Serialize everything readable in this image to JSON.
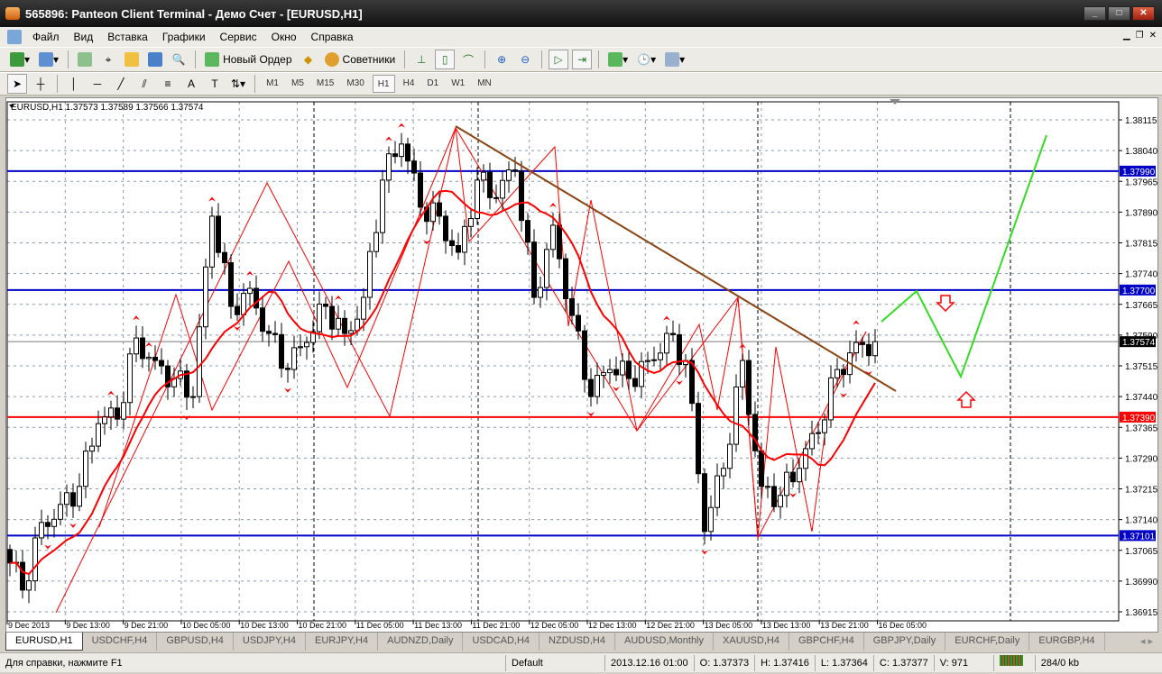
{
  "window": {
    "title": "565896: Panteon Client Terminal - Демо Счет - [EURUSD,H1]"
  },
  "menu": [
    "Файл",
    "Вид",
    "Вставка",
    "Графики",
    "Сервис",
    "Окно",
    "Справка"
  ],
  "toolbar": {
    "new_order": "Новый Ордер",
    "advisors": "Советники"
  },
  "tools": {
    "text_tool": "A"
  },
  "timeframes": [
    "M1",
    "M5",
    "M15",
    "M30",
    "H1",
    "H4",
    "D1",
    "W1",
    "MN"
  ],
  "active_timeframe": "H1",
  "chart": {
    "header": "EURUSD,H1  1.37573 1.37589 1.37566 1.37574",
    "price_ticks": [
      "1.38115",
      "1.38040",
      "1.37965",
      "1.37890",
      "1.37815",
      "1.37740",
      "1.37665",
      "1.37590",
      "1.37515",
      "1.37440",
      "1.37365",
      "1.37290",
      "1.37215",
      "1.37140",
      "1.37065",
      "1.36990",
      "1.36915"
    ],
    "time_labels": [
      "9 Dec 2013",
      "9 Dec 13:00",
      "9 Dec 21:00",
      "10 Dec 05:00",
      "10 Dec 13:00",
      "10 Dec 21:00",
      "11 Dec 05:00",
      "11 Dec 13:00",
      "11 Dec 21:00",
      "12 Dec 05:00",
      "12 Dec 13:00",
      "12 Dec 21:00",
      "13 Dec 05:00",
      "13 Dec 13:00",
      "13 Dec 21:00",
      "16 Dec 05:00"
    ],
    "levels": [
      {
        "price": "1.37990",
        "color": "#0000c8"
      },
      {
        "price": "1.37700",
        "color": "#0000c8"
      },
      {
        "price": "1.37390",
        "color": "#ff0000"
      },
      {
        "price": "1.37101",
        "color": "#0000c8"
      }
    ],
    "current_price": "1.37574",
    "closes": [
      1.37067,
      1.36968,
      1.37133,
      1.37177,
      1.37221,
      1.37374,
      1.37385,
      1.37583,
      1.37528,
      1.37484,
      1.3744,
      1.3788,
      1.3766,
      1.37704,
      1.37594,
      1.37506,
      1.37572,
      1.3766,
      1.37594,
      1.37682,
      1.37968,
      1.38056,
      1.37902,
      1.3788,
      1.37792,
      1.37968,
      1.37924,
      1.3799,
      1.37682,
      1.37858,
      1.37638,
      1.3744,
      1.37506,
      1.37484,
      1.37528,
      1.37594,
      1.37528,
      1.37111,
      1.37265,
      1.37528,
      1.37221,
      1.37199,
      1.37265,
      1.37352,
      1.37506,
      1.37572,
      1.37574
    ]
  },
  "tabs": [
    "EURUSD,H1",
    "USDCHF,H4",
    "GBPUSD,H4",
    "USDJPY,H4",
    "EURJPY,H4",
    "AUDNZD,Daily",
    "USDCAD,H4",
    "NZDUSD,H4",
    "AUDUSD,Monthly",
    "XAUUSD,H4",
    "GBPCHF,H4",
    "GBPJPY,Daily",
    "EURCHF,Daily",
    "EURGBP,H4"
  ],
  "status": {
    "help": "Для справки, нажмите F1",
    "profile": "Default",
    "time": "2013.12.16 01:00",
    "open": "O: 1.37373",
    "high": "H: 1.37416",
    "low": "L: 1.37364",
    "close": "C: 1.37377",
    "volume": "V: 971",
    "traffic": "284/0 kb"
  }
}
